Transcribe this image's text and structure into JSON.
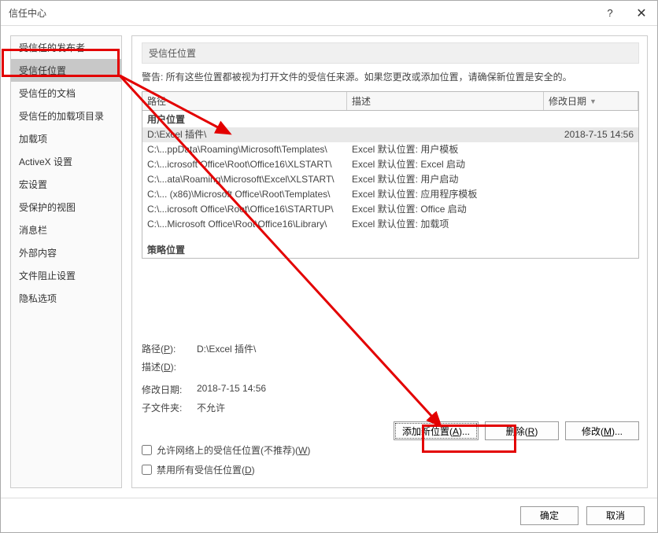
{
  "titlebar": {
    "title": "信任中心",
    "help": "?",
    "close": "✕"
  },
  "sidebar": {
    "items": [
      {
        "label": "受信任的发布者"
      },
      {
        "label": "受信任位置",
        "selected": true
      },
      {
        "label": "受信任的文档"
      },
      {
        "label": "受信任的加载项目录"
      },
      {
        "label": "加载项"
      },
      {
        "label": "ActiveX 设置"
      },
      {
        "label": "宏设置"
      },
      {
        "label": "受保护的视图"
      },
      {
        "label": "消息栏"
      },
      {
        "label": "外部内容"
      },
      {
        "label": "文件阻止设置"
      },
      {
        "label": "隐私选项"
      }
    ]
  },
  "main": {
    "header": "受信任位置",
    "warning": "警告: 所有这些位置都被视为打开文件的受信任来源。如果您更改或添加位置，请确保新位置是安全的。",
    "columns": {
      "path": "路径",
      "desc": "描述",
      "date": "修改日期"
    },
    "group_user": "用户位置",
    "group_policy": "策略位置",
    "rows": [
      {
        "path": "D:\\Excel 插件\\",
        "desc": "",
        "date": "2018-7-15 14:56",
        "selected": true
      },
      {
        "path": "C:\\...ppData\\Roaming\\Microsoft\\Templates\\",
        "desc": "Excel 默认位置: 用户模板",
        "date": ""
      },
      {
        "path": "C:\\...icrosoft Office\\Root\\Office16\\XLSTART\\",
        "desc": "Excel 默认位置: Excel 启动",
        "date": ""
      },
      {
        "path": "C:\\...ata\\Roaming\\Microsoft\\Excel\\XLSTART\\",
        "desc": "Excel 默认位置: 用户启动",
        "date": ""
      },
      {
        "path": "C:\\... (x86)\\Microsoft Office\\Root\\Templates\\",
        "desc": "Excel 默认位置: 应用程序模板",
        "date": ""
      },
      {
        "path": "C:\\...icrosoft Office\\Root\\Office16\\STARTUP\\",
        "desc": "Excel 默认位置: Office 启动",
        "date": ""
      },
      {
        "path": "C:\\...Microsoft Office\\Root\\Office16\\Library\\",
        "desc": "Excel 默认位置: 加载项",
        "date": ""
      }
    ],
    "details": {
      "path_label_pre": "路径(",
      "path_label_u": "P",
      "path_label_post": "):",
      "path_value": "D:\\Excel 插件\\",
      "desc_label_pre": "描述(",
      "desc_label_u": "D",
      "desc_label_post": "):",
      "desc_value": "",
      "date_label": "修改日期:",
      "date_value": "2018-7-15 14:56",
      "sub_label": "子文件夹:",
      "sub_value": "不允许"
    },
    "buttons": {
      "add_pre": "添加新位置(",
      "add_u": "A",
      "add_post": ")...",
      "remove_pre": "删除(",
      "remove_u": "R",
      "remove_post": ")",
      "modify_pre": "修改(",
      "modify_u": "M",
      "modify_post": ")..."
    },
    "checks": {
      "net_pre": "允许网络上的受信任位置(不推荐)(",
      "net_u": "W",
      "net_post": ")",
      "disable_pre": "禁用所有受信任位置(",
      "disable_u": "D",
      "disable_post": ")"
    }
  },
  "footer": {
    "ok": "确定",
    "cancel": "取消"
  }
}
